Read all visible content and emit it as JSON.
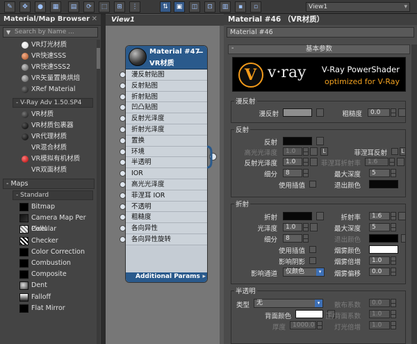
{
  "toolbar": {
    "view_selector": "View1",
    "view_arrow": "▾"
  },
  "browser": {
    "title": "Material/Map Browser",
    "close": "✕",
    "search_placeholder": "Search by Name ...",
    "vray_materials_top": [
      {
        "label": "VR灯光材质",
        "swatch": "white"
      },
      {
        "label": "VR快速SSS",
        "swatch": "orange"
      },
      {
        "label": "VR快速SSS2",
        "swatch": "grey"
      },
      {
        "label": "VR矢量置换烘焙",
        "swatch": "grey"
      },
      {
        "label": "XRef Material",
        "swatch": "shadow"
      }
    ],
    "vray_group": "- V-Ray Adv 1.50.SP4",
    "vray_materials": [
      {
        "label": "VR材质",
        "swatch": "shadow"
      },
      {
        "label": "VR材质包裹器",
        "swatch": "black"
      },
      {
        "label": "VR代理材质",
        "swatch": "black"
      },
      {
        "label": "VR混合材质",
        "swatch": "none"
      },
      {
        "label": "VR模拟有机材质",
        "swatch": "red"
      },
      {
        "label": "VR双面材质",
        "swatch": "none"
      }
    ],
    "maps_section": "- Maps",
    "standard_group": "- Standard",
    "maps": [
      {
        "label": "Bitmap",
        "swatch": "black"
      },
      {
        "label": "Camera Map Per Pixel",
        "swatch": "cmap"
      },
      {
        "label": "Cellular",
        "swatch": "cell"
      },
      {
        "label": "Checker",
        "swatch": "check"
      },
      {
        "label": "Color Correction",
        "swatch": "black"
      },
      {
        "label": "Combustion",
        "swatch": "black"
      },
      {
        "label": "Composite",
        "swatch": "black"
      },
      {
        "label": "Dent",
        "swatch": "dent"
      },
      {
        "label": "Falloff",
        "swatch": "fall"
      },
      {
        "label": "Flat Mirror",
        "swatch": "black"
      }
    ]
  },
  "view": {
    "tab": "View1"
  },
  "node": {
    "title": "Material #47",
    "subtitle": "VR材质",
    "minimize": "−",
    "slots": [
      "漫反射贴图",
      "反射贴图",
      "折射贴图",
      "凹凸贴图",
      "反射光泽度",
      "折射光泽度",
      "置换",
      "环境",
      "半透明",
      "IOR",
      "高光光泽度",
      "菲涅耳 IOR",
      "不透明",
      "粗糙度",
      "各向异性",
      "各向异性旋转"
    ],
    "footer": "Additional Params",
    "footer_arrow": "▸"
  },
  "editor": {
    "title": "Material #46 （VR材质）",
    "name_field": "Material #46",
    "rollout": "基本参数",
    "rollout_toggle": "-",
    "banner_logo": "v·ray",
    "banner_line1": "V-Ray PowerShader",
    "banner_line2": "optimized for V-Ray",
    "diffuse": {
      "group": "漫反射",
      "label": "漫反射",
      "color": "#8e8e8e",
      "roughness_label": "粗糙度",
      "roughness": "0.0"
    },
    "reflection": {
      "group": "反射",
      "reflect_label": "反射",
      "reflect_color": "#080808",
      "hilight_gloss_label": "高光光泽度",
      "hilight_gloss": "1.0",
      "L_button": "L",
      "fresnel_label": "菲涅耳反射",
      "refl_gloss_label": "反射光泽度",
      "refl_gloss": "1.0",
      "fresnel_ior_label": "菲涅耳折射率",
      "fresnel_ior": "1.6",
      "subdivs_label": "细分",
      "subdivs": "8",
      "max_depth_label": "最大深度",
      "max_depth": "5",
      "use_interp_label": "使用插值",
      "exit_color_label": "退出颜色",
      "exit_color": "#080808"
    },
    "refraction": {
      "group": "折射",
      "refract_label": "折射",
      "refract_color": "#080808",
      "ior_label": "折射率",
      "ior": "1.6",
      "gloss_label": "光泽度",
      "gloss": "1.0",
      "max_depth_label": "最大深度",
      "max_depth": "5",
      "subdivs_label": "细分",
      "subdivs": "8",
      "exit_color_label": "退出颜色",
      "exit_color": "#000000",
      "use_interp_label": "使用插值",
      "fog_color_label": "烟雾颜色",
      "fog_color": "#ffffff",
      "affect_shadows_label": "影响阴影",
      "fog_mult_label": "烟雾倍增",
      "fog_mult": "1.0",
      "affect_channels_label": "影响通道",
      "affect_channels": "仅颜色",
      "fog_bias_label": "烟雾偏移",
      "fog_bias": "0.0"
    },
    "translucency": {
      "group": "半透明",
      "type_label": "类型",
      "type": "无",
      "scatter_label": "散布系数",
      "scatter": "0.0",
      "back_color_label": "背面颜色",
      "back_color": "#ffffff",
      "fwd_back_label": "正/背面系数",
      "fwd_back": "1.0",
      "thickness_label": "厚度",
      "thickness": "1000.0",
      "light_mult_label": "灯光倍增",
      "light_mult": "1.0"
    }
  }
}
